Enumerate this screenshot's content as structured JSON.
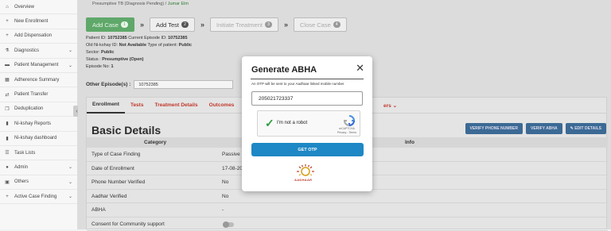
{
  "sidebar": {
    "items": [
      {
        "label": "Overview",
        "icon": "home-icon",
        "glyph": "⌂",
        "chev": ""
      },
      {
        "label": "New Enrollment",
        "icon": "plus-icon",
        "glyph": "+",
        "chev": ""
      },
      {
        "label": "Add Dispensation",
        "icon": "plus-icon",
        "glyph": "+",
        "chev": ""
      },
      {
        "label": "Diagnostics",
        "icon": "flask-icon",
        "glyph": "⚗",
        "chev": "⌄"
      },
      {
        "label": "Patient Management",
        "icon": "patient-icon",
        "glyph": "▬",
        "chev": "⌄"
      },
      {
        "label": "Adherence Summary",
        "icon": "calendar-icon",
        "glyph": "▦",
        "chev": ""
      },
      {
        "label": "Patient Transfer",
        "icon": "transfer-icon",
        "glyph": "⇄",
        "chev": ""
      },
      {
        "label": "Deduplication",
        "icon": "copy-icon",
        "glyph": "❐",
        "chev": ""
      },
      {
        "label": "Ni-kshay Reports",
        "icon": "chart-icon",
        "glyph": "▮",
        "chev": ""
      },
      {
        "label": "Ni-kshay dashboard",
        "icon": "dashboard-icon",
        "glyph": "▮",
        "chev": ""
      },
      {
        "label": "Task Lists",
        "icon": "list-icon",
        "glyph": "☰",
        "chev": ""
      },
      {
        "label": "Admin",
        "icon": "user-icon",
        "glyph": "●",
        "chev": "⌄"
      },
      {
        "label": "Others",
        "icon": "briefcase-icon",
        "glyph": "▣",
        "chev": "⌄"
      },
      {
        "label": "Active Case Finding",
        "icon": "plus-icon",
        "glyph": "+",
        "chev": "⌄"
      }
    ]
  },
  "breadcrumb": {
    "current": "Presumptive TB (Diagnosis Pending)",
    "sep": "/",
    "link": "Jumar Elm"
  },
  "steps": [
    {
      "label": "Add Case",
      "count": "1",
      "state": "active"
    },
    {
      "label": "Add Test",
      "count": "2",
      "state": "normal"
    },
    {
      "label": "Initiate Treatment",
      "count": "3",
      "state": "disabled"
    },
    {
      "label": "Close Case",
      "count": "4",
      "state": "disabled"
    }
  ],
  "patient": {
    "patient_id_label": "Patient ID:",
    "patient_id": "10752385",
    "episode_id_label": "Current Episode ID:",
    "episode_id": "10752385",
    "old_id_label": "Old Ni-kshay ID:",
    "old_id": "Not Available",
    "type_label": "Type of patient:",
    "type": "Public",
    "sector_label": "Sector:",
    "sector": "Public",
    "status_label": "Status :",
    "status": "Presumptive (Open)",
    "episode_no_label": "Episode No:",
    "episode_no": "1",
    "other_episodes_label": "Other Episode(s) :",
    "other_episodes": "10752385"
  },
  "tabs": [
    "Enrollment",
    "Tests",
    "Treatment Details",
    "Outcomes"
  ],
  "tabs_more": "ers ⌄",
  "basic_details": {
    "title": "Basic Details",
    "buttons": [
      "VERIFY PHONE NUMBER",
      "VERIFY ABHA",
      "✎ EDIT DETAILS"
    ],
    "col_category": "Category",
    "col_info": "Info",
    "rows": [
      {
        "k": "Type of Case Finding",
        "v": "Passive ("
      },
      {
        "k": "Date of Enrollment",
        "v": "17-08-20"
      },
      {
        "k": "Phone Number Verified",
        "v": "No"
      },
      {
        "k": "Aadhar Verified",
        "v": "No"
      },
      {
        "k": "ABHA",
        "v": "-"
      },
      {
        "k": "Consent for Community support",
        "v": ""
      }
    ]
  },
  "modal": {
    "title": "Generate ABHA",
    "close": "✕",
    "note": "An OTP will be sent to your Aadhaar linked mobile number",
    "aadhaar_value": "205021723337",
    "captcha_label": "I'm not a robot",
    "captcha_brand": "reCAPTCHA",
    "captcha_terms": "Privacy - Terms",
    "otp_button": "GET OTP",
    "logo_text": "AADHAAR"
  },
  "colors": {
    "accent": "#1e87c5",
    "active_step": "#5fa86a",
    "tab_red": "#c0392b",
    "button_blue": "#3c6a95"
  }
}
